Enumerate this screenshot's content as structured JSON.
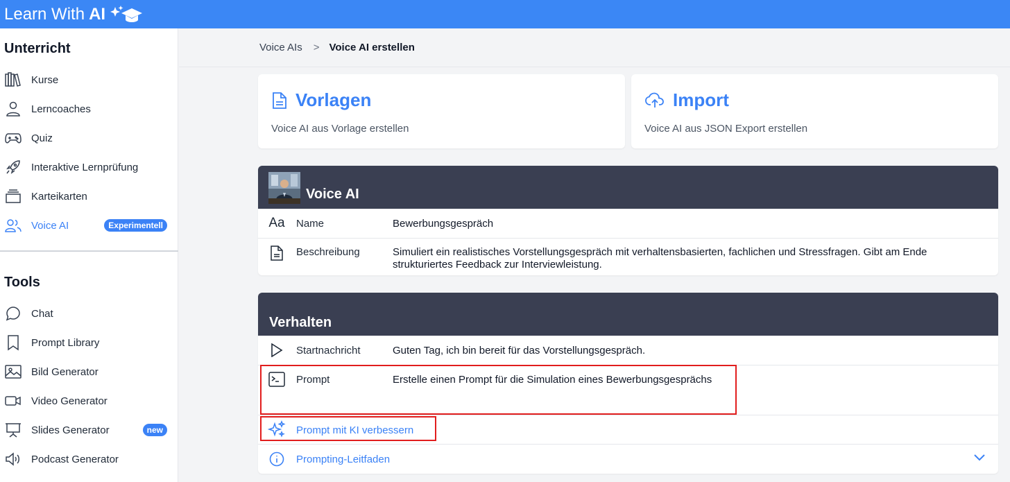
{
  "app": {
    "logo_text": "Learn With",
    "logo_bold": "AI"
  },
  "sidebar": {
    "section1_title": "Unterricht",
    "section1_items": [
      {
        "label": "Kurse",
        "icon": "books-icon"
      },
      {
        "label": "Lerncoaches",
        "icon": "user-icon"
      },
      {
        "label": "Quiz",
        "icon": "gamepad-icon"
      },
      {
        "label": "Interaktive Lernprüfung",
        "icon": "rocket-icon"
      },
      {
        "label": "Karteikarten",
        "icon": "cards-icon"
      },
      {
        "label": "Voice AI",
        "icon": "users-icon",
        "badge": "Experimentell",
        "active": true
      }
    ],
    "section2_title": "Tools",
    "section2_items": [
      {
        "label": "Chat",
        "icon": "chat-icon"
      },
      {
        "label": "Prompt Library",
        "icon": "bookmark-icon"
      },
      {
        "label": "Bild Generator",
        "icon": "image-icon"
      },
      {
        "label": "Video Generator",
        "icon": "video-icon"
      },
      {
        "label": "Slides Generator",
        "icon": "presentation-icon",
        "badge": "new"
      },
      {
        "label": "Podcast Generator",
        "icon": "speaker-icon"
      }
    ]
  },
  "breadcrumb": {
    "parent": "Voice AIs",
    "separator": ">",
    "current": "Voice AI erstellen"
  },
  "cards": {
    "templates": {
      "title": "Vorlagen",
      "subtitle": "Voice AI aus Vorlage erstellen",
      "icon": "document-icon"
    },
    "import": {
      "title": "Import",
      "subtitle": "Voice AI aus JSON Export erstellen",
      "icon": "cloud-upload-icon"
    }
  },
  "voice_ai": {
    "title": "Voice AI",
    "name_label": "Name",
    "name_value": "Bewerbungsgespräch",
    "description_label": "Beschreibung",
    "description_value": "Simuliert ein realistisches Vorstellungsgespräch mit verhaltensbasierten, fachlichen und Stressfragen. Gibt am Ende strukturiertes Feedback zur Interviewleistung."
  },
  "behavior": {
    "title": "Verhalten",
    "start_label": "Startnachricht",
    "start_value": "Guten Tag, ich bin bereit für das Vorstellungsgespräch.",
    "prompt_label": "Prompt",
    "prompt_value": "Erstelle einen Prompt für die Simulation eines Bewerbungsgesprächs",
    "improve_label": "Prompt mit KI verbessern",
    "guide_label": "Prompting-Leitfaden"
  },
  "colors": {
    "accent": "#3b82f6",
    "topbar": "#3b87f5",
    "panel_header": "#3a3f52",
    "highlight": "#e11d1d"
  }
}
